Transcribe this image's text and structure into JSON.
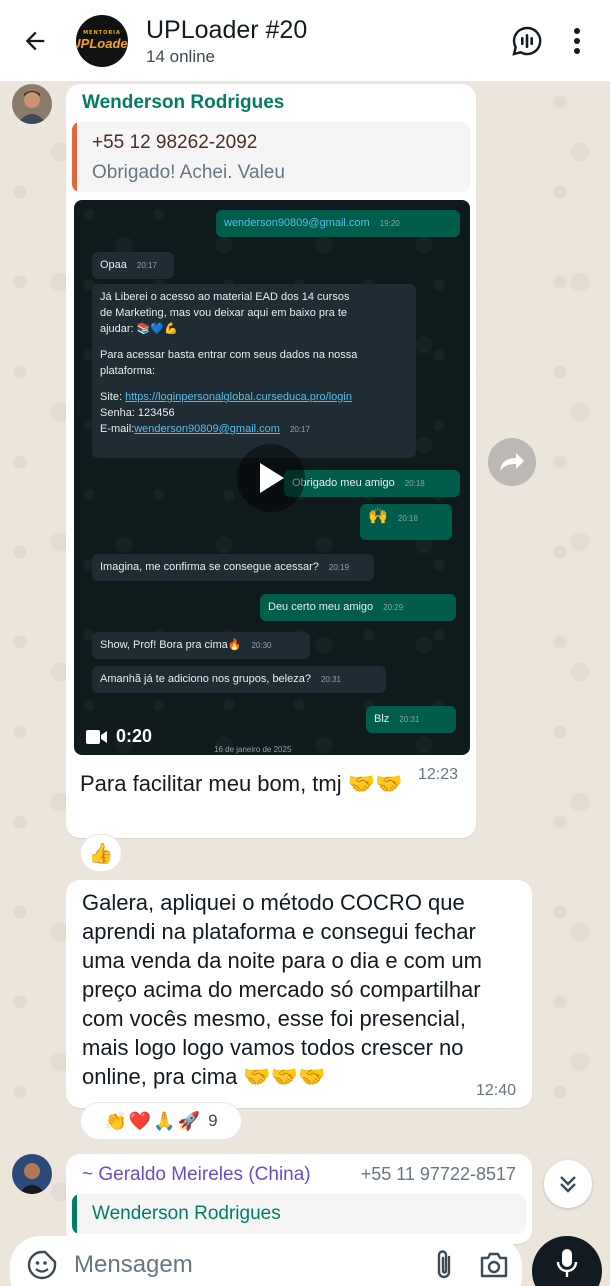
{
  "header": {
    "title": "UPLoader #20",
    "subtitle": "14 online",
    "avatar_top": "MENTORIA",
    "avatar_main": "UPLoader"
  },
  "message1": {
    "sender": "Wenderson Rodrigues",
    "sender_color": "#027d64",
    "quote": {
      "title": "+55 12 98262-2092",
      "text": "Obrigado! Achei. Valeu",
      "bar_color": "#e2683c"
    },
    "video": {
      "duration": "0:20",
      "date_label": "16 de janeiro de 2025",
      "messages": [
        {
          "dir": "out",
          "text": "wenderson90809@gmail.com",
          "time": "19:20"
        },
        {
          "dir": "in",
          "text": "Opaa",
          "time": "20:17"
        },
        {
          "dir": "in",
          "line1": "Já Liberei o acesso ao material EAD dos 14 cursos",
          "line2": "de Marketing, mas vou deixar aqui em baixo pra te",
          "line3": "ajudar: 📚💙💪",
          "line4": "Para acessar basta entrar com seus dados na nossa",
          "line5": "plataforma:",
          "site_label": "Site: ",
          "site_link": "https://loginpersonalglobal.curseduca.pro/login",
          "senha": "Senha: 123456",
          "email_label": "E-mail:",
          "email_link": "wenderson90809@gmail.com",
          "time": "20:17"
        },
        {
          "dir": "out",
          "text": "Obrigado meu amigo",
          "time": "20:18"
        },
        {
          "dir": "out",
          "text": "🙌",
          "time": "20:18"
        },
        {
          "dir": "in",
          "text": "Imagina, me confirma se consegue acessar?",
          "time": "20:19"
        },
        {
          "dir": "out",
          "text": "Deu certo meu amigo",
          "time": "20:29"
        },
        {
          "dir": "in",
          "text": "Show, Prof! Bora pra cima🔥",
          "time": "20:30"
        },
        {
          "dir": "in",
          "text": "Amanhã já te adiciono nos grupos, beleza?",
          "time": "20:31"
        },
        {
          "dir": "out",
          "text": "Blz",
          "time": "20:31"
        }
      ]
    },
    "caption": "Para facilitar meu bom, tmj 🤝🤝",
    "time": "12:23",
    "reaction": "👍"
  },
  "message2": {
    "line1": "Galera, apliquei o método COCRO que",
    "line2": "aprendi na plataforma e consegui fechar",
    "line3": "uma venda da noite para o dia e com um",
    "line4": "preço acima do mercado só compartilhar",
    "line5": "com vocês mesmo, esse foi presencial,",
    "line6": "mais logo logo vamos todos crescer no",
    "line7": "online, pra cima 🤝🤝🤝",
    "time": "12:40",
    "reactions": "👏❤️🙏🚀",
    "reaction_count": "9"
  },
  "message3": {
    "sender": "~ Geraldo Meireles (China)",
    "sender_color": "#6f4bc3",
    "phone": "+55 11 97722-8517",
    "quote_title": "Wenderson Rodrigues",
    "quote_color": "#027d64"
  },
  "composer": {
    "placeholder": "Mensagem"
  }
}
